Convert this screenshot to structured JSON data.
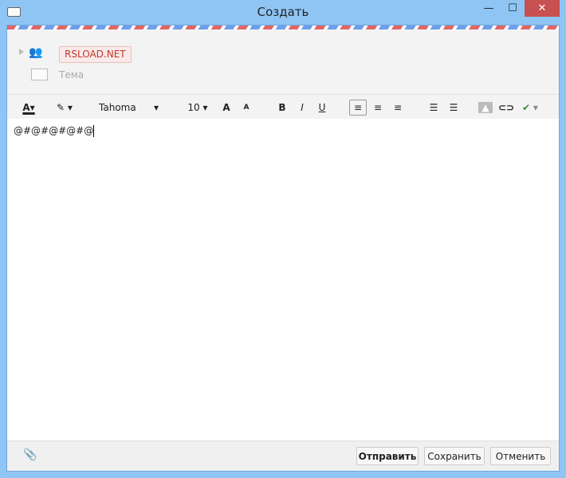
{
  "window": {
    "title": "Создать",
    "minimize": "—",
    "maximize": "☐",
    "close": "✕"
  },
  "header": {
    "recipient": "RSLOAD.NET",
    "subject_placeholder": "Тема"
  },
  "toolbar": {
    "font_color": "A",
    "font": "Tahoma",
    "size": "10",
    "grow": "A",
    "shrink": "A",
    "bold": "B",
    "italic": "I",
    "underline": "U",
    "dropdown": "▾"
  },
  "editor": {
    "text": "@#@#@#@#@"
  },
  "footer": {
    "send": "Отправить",
    "save": "Сохранить",
    "cancel": "Отменить"
  }
}
